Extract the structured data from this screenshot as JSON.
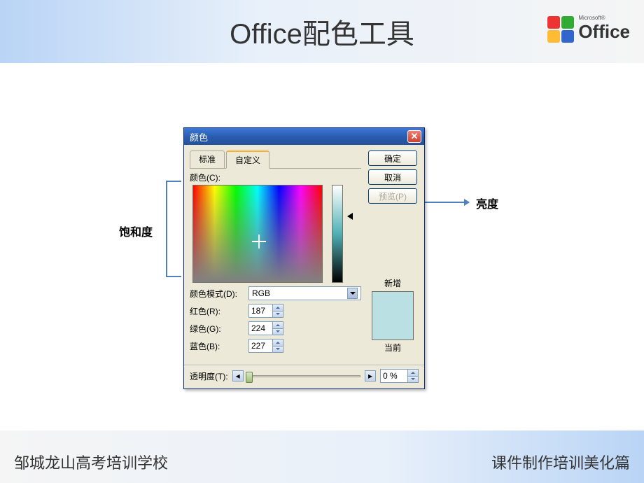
{
  "header": {
    "title": "Office配色工具",
    "logo_text": "Office",
    "logo_brand": "Microsoft®"
  },
  "dialog": {
    "title": "颜色",
    "tabs": {
      "standard": "标准",
      "custom": "自定义"
    },
    "color_label": "颜色(C):",
    "mode_label": "颜色模式(D):",
    "mode_value": "RGB",
    "red_label": "红色(R):",
    "red_value": "187",
    "green_label": "绿色(G):",
    "green_value": "224",
    "blue_label": "蓝色(B):",
    "blue_value": "227",
    "transparency_label": "透明度(T):",
    "transparency_value": "0 %",
    "ok_button": "确定",
    "cancel_button": "取消",
    "preview_button": "预览(P)",
    "new_label": "新增",
    "current_label": "当前"
  },
  "annotations": {
    "saturation": "饱和度",
    "luminance": "亮度"
  },
  "footer": {
    "left": "邹城龙山高考培训学校",
    "right": "课件制作培训美化篇"
  }
}
